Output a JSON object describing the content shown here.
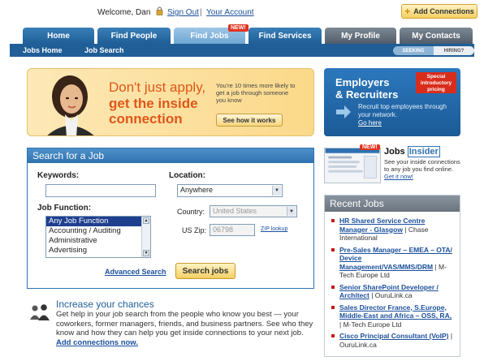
{
  "header": {
    "welcome": "Welcome, Dan",
    "sign_out": "Sign Out",
    "separator": "|",
    "your_account": "Your Account",
    "add_connections": "Add Connections"
  },
  "nav": {
    "tabs": [
      {
        "label": "Home"
      },
      {
        "label": "Find People"
      },
      {
        "label": "Find Jobs",
        "badge": "NEW!"
      },
      {
        "label": "Find Services"
      },
      {
        "label": "My Profile"
      },
      {
        "label": "My Contacts"
      }
    ]
  },
  "subnav": {
    "items": [
      "Jobs Home",
      "Job Search"
    ],
    "seeking": "SEEKING",
    "hiring": "HIRING?"
  },
  "promo": {
    "line1": "Don't just apply,",
    "line2": "get the inside",
    "line3": "connection",
    "sub": "You're 10 times more likely to get a job through someone you know",
    "button": "See how it works"
  },
  "employers": {
    "line1": "Employers",
    "line2": "& Recruiters",
    "special": "Special introductory pricing",
    "desc": "Recruit top employees through your network.",
    "link": "Go here"
  },
  "search": {
    "title": "Search for a Job",
    "keywords_label": "Keywords:",
    "keywords_value": "",
    "location_label": "Location:",
    "location_value": "Anywhere",
    "job_function_label": "Job Function:",
    "job_functions": [
      "Any Job Function",
      "Accounting / Auditing",
      "Administrative",
      "Advertising"
    ],
    "country_label": "Country:",
    "country_value": "United States",
    "zip_label": "US Zip:",
    "zip_value": "06798",
    "zip_lookup": "ZIP lookup",
    "advanced": "Advanced Search",
    "button": "Search jobs"
  },
  "increase": {
    "title": "Increase your chances",
    "body": "Get help in your job search from the people who know you best — your coworkers, former managers, friends, and business partners. See who they know and how they can help you get inside connections to your next job.",
    "link": "Add connections now."
  },
  "insider": {
    "badge": "NEW!",
    "title_a": "Jobs",
    "title_b": "Insider",
    "desc": "See your inside connections to any job you find online.",
    "link": "Get it now!"
  },
  "recent": {
    "title": "Recent Jobs",
    "jobs": [
      {
        "title": "HR Shared Service Centre Manager - Glasgow",
        "company": " | Chase International"
      },
      {
        "title": "Pre-Sales Manager – EMEA – OTA/ Device Management/VAS/MMS/DRM",
        "company": " | M-Tech Europe Ltd"
      },
      {
        "title": "Senior SharePoint Developer / Architect",
        "company": " | OuruLink.ca"
      },
      {
        "title": "Sales Director France, S.Europe, Middle-East and Africa – OSS, RA,",
        "company": " | M-Tech Europe Ltd"
      },
      {
        "title": "Cisco Principal Consultant (VoIP)",
        "company": " | OuruLink.ca"
      }
    ]
  },
  "colors": {
    "nav_blue": "#1f5e96",
    "accent_orange": "#e0571a",
    "badge_red": "#e0341f"
  }
}
